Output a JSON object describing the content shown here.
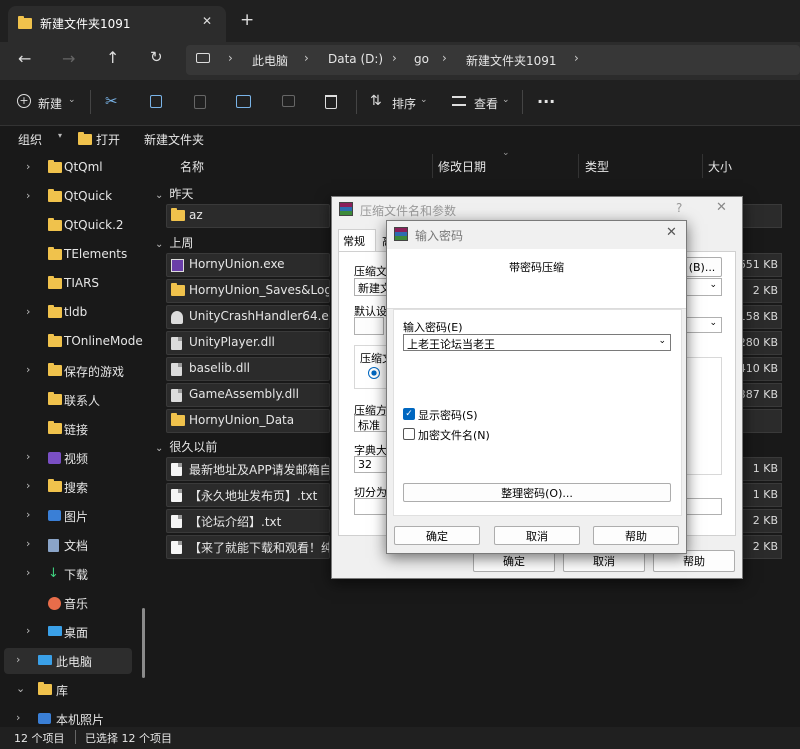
{
  "window": {
    "tab_title": "新建文件夹1091",
    "new_tab": "+",
    "close": "✕"
  },
  "address": {
    "crumbs": [
      "此电脑",
      "Data (D:)",
      "go",
      "新建文件夹1091"
    ]
  },
  "toolbar": {
    "new": "新建",
    "sort": "排序",
    "view": "查看",
    "more": "···"
  },
  "subbar": {
    "organize": "组织",
    "open": "打开",
    "new_folder": "新建文件夹"
  },
  "columns": {
    "name": "名称",
    "modified": "修改日期",
    "type": "类型",
    "size": "大小"
  },
  "groups": {
    "yesterday": "昨天",
    "last_week": "上周",
    "long_ago": "很久以前"
  },
  "files": [
    {
      "name": "az",
      "size": "",
      "kind": "folder"
    },
    {
      "name": "HornyUnion.exe",
      "size": "651 KB",
      "kind": "exe"
    },
    {
      "name": "HornyUnion_Saves&Logs",
      "size": "2 KB",
      "kind": "lnk"
    },
    {
      "name": "UnityCrashHandler64.exe",
      "size": "158 KB",
      "kind": "unity"
    },
    {
      "name": "UnityPlayer.dll",
      "size": "280 KB",
      "kind": "dll"
    },
    {
      "name": "baselib.dll",
      "size": "410 KB",
      "kind": "dll"
    },
    {
      "name": "GameAssembly.dll",
      "size": "387 KB",
      "kind": "dll"
    },
    {
      "name": "HornyUnion_Data",
      "size": "",
      "kind": "folder"
    },
    {
      "name": "最新地址及APP请发邮箱自动",
      "size": "1 KB",
      "kind": "txt"
    },
    {
      "name": "【永久地址发布页】.txt",
      "size": "1 KB",
      "kind": "txt"
    },
    {
      "name": "【论坛介绍】.txt",
      "size": "2 KB",
      "kind": "txt"
    },
    {
      "name": "【来了就能下载和观看！纯免",
      "size": "2 KB",
      "kind": "txt"
    }
  ],
  "sidebar": [
    {
      "label": "QtQml",
      "chev": "›",
      "icon": "folder"
    },
    {
      "label": "QtQuick",
      "chev": "›",
      "icon": "folder"
    },
    {
      "label": "QtQuick.2",
      "chev": "",
      "icon": "folder"
    },
    {
      "label": "TElements",
      "chev": "",
      "icon": "folder"
    },
    {
      "label": "TIARS",
      "chev": "",
      "icon": "folder"
    },
    {
      "label": "tldb",
      "chev": "›",
      "icon": "folder"
    },
    {
      "label": "TOnlineMode",
      "chev": "",
      "icon": "folder"
    },
    {
      "label": "保存的游戏",
      "chev": "›",
      "icon": "folder"
    },
    {
      "label": "联系人",
      "chev": "",
      "icon": "folder"
    },
    {
      "label": "链接",
      "chev": "",
      "icon": "folder"
    },
    {
      "label": "视频",
      "chev": "›",
      "icon": "video"
    },
    {
      "label": "搜索",
      "chev": "›",
      "icon": "folder"
    },
    {
      "label": "图片",
      "chev": "›",
      "icon": "picture"
    },
    {
      "label": "文档",
      "chev": "›",
      "icon": "document"
    },
    {
      "label": "下载",
      "chev": "›",
      "icon": "download"
    },
    {
      "label": "音乐",
      "chev": "",
      "icon": "music"
    },
    {
      "label": "桌面",
      "chev": "›",
      "icon": "desktop"
    },
    {
      "label": "此电脑",
      "chev": "›",
      "icon": "pc"
    },
    {
      "label": "库",
      "chev": "⌄",
      "icon": "folder"
    },
    {
      "label": "本机照片",
      "chev": "›",
      "icon": "picture"
    }
  ],
  "status": {
    "count": "12 个项目",
    "selected": "已选择 12 个项目"
  },
  "archive_dialog": {
    "title": "压缩文件名和参数",
    "help": "?",
    "tab_general": "常规",
    "tab_second": "高",
    "lbl_filename": "压缩文件",
    "filename_value": "新建文",
    "browse": "(B)...",
    "lbl_default": "默认设",
    "lbl_format": "压缩文",
    "lbl_method": "压缩方",
    "method_value": "标准",
    "lbl_dict": "字典大小",
    "dict_value": "32",
    "lbl_split": "切分为分",
    "ok": "确定",
    "cancel": "取消",
    "helpbtn": "帮助"
  },
  "password_dialog": {
    "title": "输入密码",
    "subtitle": "带密码压缩",
    "lbl_enter": "输入密码(E)",
    "password_value": "上老王论坛当老王",
    "show_password": "显示密码(S)",
    "encrypt_names": "加密文件名(N)",
    "organize": "整理密码(O)...",
    "ok": "确定",
    "cancel": "取消",
    "help": "帮助"
  },
  "colors": {
    "accent": "#0067c0",
    "folder": "#f0c24c",
    "bg": "#191919"
  }
}
